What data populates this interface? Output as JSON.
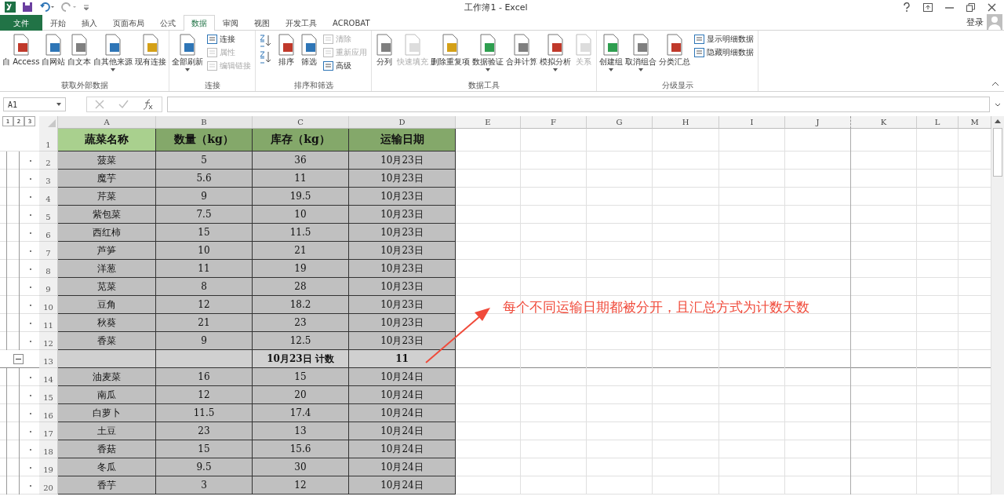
{
  "window": {
    "title": "工作簿1 - Excel"
  },
  "tabs": [
    {
      "label": "文件",
      "kind": "file",
      "selected": false
    },
    {
      "label": "开始",
      "kind": "tab",
      "selected": false
    },
    {
      "label": "插入",
      "kind": "tab",
      "selected": false
    },
    {
      "label": "页面布局",
      "kind": "tab",
      "selected": false
    },
    {
      "label": "公式",
      "kind": "tab",
      "selected": false
    },
    {
      "label": "数据",
      "kind": "tab",
      "selected": true
    },
    {
      "label": "审阅",
      "kind": "tab",
      "selected": false
    },
    {
      "label": "视图",
      "kind": "tab",
      "selected": false
    },
    {
      "label": "开发工具",
      "kind": "tab",
      "selected": false
    },
    {
      "label": "ACROBAT",
      "kind": "tab",
      "selected": false
    }
  ],
  "account": {
    "label": "登录"
  },
  "ribbon_groups": [
    {
      "title": "获取外部数据",
      "items": [
        {
          "kind": "large",
          "label": "自 Access",
          "disabled": false,
          "dropdown": false
        },
        {
          "kind": "large",
          "label": "自网站",
          "disabled": false,
          "dropdown": false
        },
        {
          "kind": "large",
          "label": "自文本",
          "disabled": false,
          "dropdown": false
        },
        {
          "kind": "large",
          "label": "自其他来源",
          "disabled": false,
          "dropdown": true
        },
        {
          "kind": "large",
          "label": "现有连接",
          "disabled": false,
          "dropdown": false
        }
      ]
    },
    {
      "title": "连接",
      "items": [
        {
          "kind": "large",
          "label": "全部刷新",
          "disabled": false,
          "dropdown": true
        },
        {
          "kind": "stack",
          "items": [
            {
              "label": "连接",
              "disabled": false
            },
            {
              "label": "属性",
              "disabled": true
            },
            {
              "label": "编辑链接",
              "disabled": true
            }
          ]
        }
      ]
    },
    {
      "title": "排序和筛选",
      "items": [
        {
          "kind": "sort-icons"
        },
        {
          "kind": "large",
          "label": "排序",
          "disabled": false,
          "dropdown": false
        },
        {
          "kind": "large",
          "label": "筛选",
          "disabled": false,
          "dropdown": false
        },
        {
          "kind": "stack",
          "items": [
            {
              "label": "清除",
              "disabled": true
            },
            {
              "label": "重新应用",
              "disabled": true
            },
            {
              "label": "高级",
              "disabled": false
            }
          ]
        }
      ]
    },
    {
      "title": "数据工具",
      "items": [
        {
          "kind": "large",
          "label": "分列",
          "disabled": false,
          "dropdown": false
        },
        {
          "kind": "large",
          "label": "快速填充",
          "disabled": true,
          "dropdown": false
        },
        {
          "kind": "large",
          "label": "删除重复项",
          "disabled": false,
          "dropdown": false
        },
        {
          "kind": "large",
          "label": "数据验证",
          "disabled": false,
          "dropdown": true
        },
        {
          "kind": "large",
          "label": "合并计算",
          "disabled": false,
          "dropdown": false
        },
        {
          "kind": "large",
          "label": "模拟分析",
          "disabled": false,
          "dropdown": true
        },
        {
          "kind": "large",
          "label": "关系",
          "disabled": true,
          "dropdown": false
        }
      ]
    },
    {
      "title": "分级显示",
      "items": [
        {
          "kind": "large",
          "label": "创建组",
          "disabled": false,
          "dropdown": true
        },
        {
          "kind": "large",
          "label": "取消组合",
          "disabled": false,
          "dropdown": true
        },
        {
          "kind": "large",
          "label": "分类汇总",
          "disabled": false,
          "dropdown": false
        },
        {
          "kind": "stack",
          "items": [
            {
              "label": "显示明细数据",
              "disabled": false
            },
            {
              "label": "隐藏明细数据",
              "disabled": false
            }
          ]
        }
      ]
    }
  ],
  "name_box": {
    "value": "A1"
  },
  "outline_levels": [
    "1",
    "2",
    "3"
  ],
  "columns": [
    "A",
    "B",
    "C",
    "D",
    "E",
    "F",
    "G",
    "H",
    "I",
    "J",
    "K",
    "L",
    "M"
  ],
  "rows": [
    {
      "num": "1",
      "kind": "header",
      "cells": [
        "蔬菜名称",
        "数量（kg）",
        "库存（kg）",
        "运输日期"
      ]
    },
    {
      "num": "2",
      "kind": "data",
      "cells": [
        "菠菜",
        "5",
        "36",
        "10月23日"
      ]
    },
    {
      "num": "3",
      "kind": "data",
      "cells": [
        "魔芋",
        "5.6",
        "11",
        "10月23日"
      ]
    },
    {
      "num": "4",
      "kind": "data",
      "cells": [
        "芹菜",
        "9",
        "19.5",
        "10月23日"
      ]
    },
    {
      "num": "5",
      "kind": "data",
      "cells": [
        "紫包菜",
        "7.5",
        "10",
        "10月23日"
      ]
    },
    {
      "num": "6",
      "kind": "data",
      "cells": [
        "西红柿",
        "15",
        "11.5",
        "10月23日"
      ]
    },
    {
      "num": "7",
      "kind": "data",
      "cells": [
        "芦笋",
        "10",
        "21",
        "10月23日"
      ]
    },
    {
      "num": "8",
      "kind": "data",
      "cells": [
        "洋葱",
        "11",
        "19",
        "10月23日"
      ]
    },
    {
      "num": "9",
      "kind": "data",
      "cells": [
        "苋菜",
        "8",
        "28",
        "10月23日"
      ]
    },
    {
      "num": "10",
      "kind": "data",
      "cells": [
        "豆角",
        "12",
        "18.2",
        "10月23日"
      ]
    },
    {
      "num": "11",
      "kind": "data",
      "cells": [
        "秋葵",
        "21",
        "23",
        "10月23日"
      ]
    },
    {
      "num": "12",
      "kind": "data",
      "cells": [
        "香菜",
        "9",
        "12.5",
        "10月23日"
      ]
    },
    {
      "num": "13",
      "kind": "subtotal",
      "expanded": true,
      "cells": [
        "",
        "",
        "10月23日 计数",
        "11"
      ]
    },
    {
      "num": "14",
      "kind": "data",
      "cells": [
        "油麦菜",
        "16",
        "15",
        "10月24日"
      ]
    },
    {
      "num": "15",
      "kind": "data",
      "cells": [
        "南瓜",
        "12",
        "20",
        "10月24日"
      ]
    },
    {
      "num": "16",
      "kind": "data",
      "cells": [
        "白萝卜",
        "11.5",
        "17.4",
        "10月24日"
      ]
    },
    {
      "num": "17",
      "kind": "data",
      "cells": [
        "土豆",
        "23",
        "13",
        "10月24日"
      ]
    },
    {
      "num": "18",
      "kind": "data",
      "cells": [
        "香菇",
        "15",
        "15.6",
        "10月24日"
      ]
    },
    {
      "num": "19",
      "kind": "data",
      "cells": [
        "冬瓜",
        "9.5",
        "30",
        "10月24日"
      ]
    },
    {
      "num": "20",
      "kind": "data",
      "cells": [
        "香芋",
        "3",
        "12",
        "10月24日"
      ]
    }
  ],
  "annotation": {
    "text": "每个不同运输日期都被分开，且汇总方式为计数天数"
  }
}
